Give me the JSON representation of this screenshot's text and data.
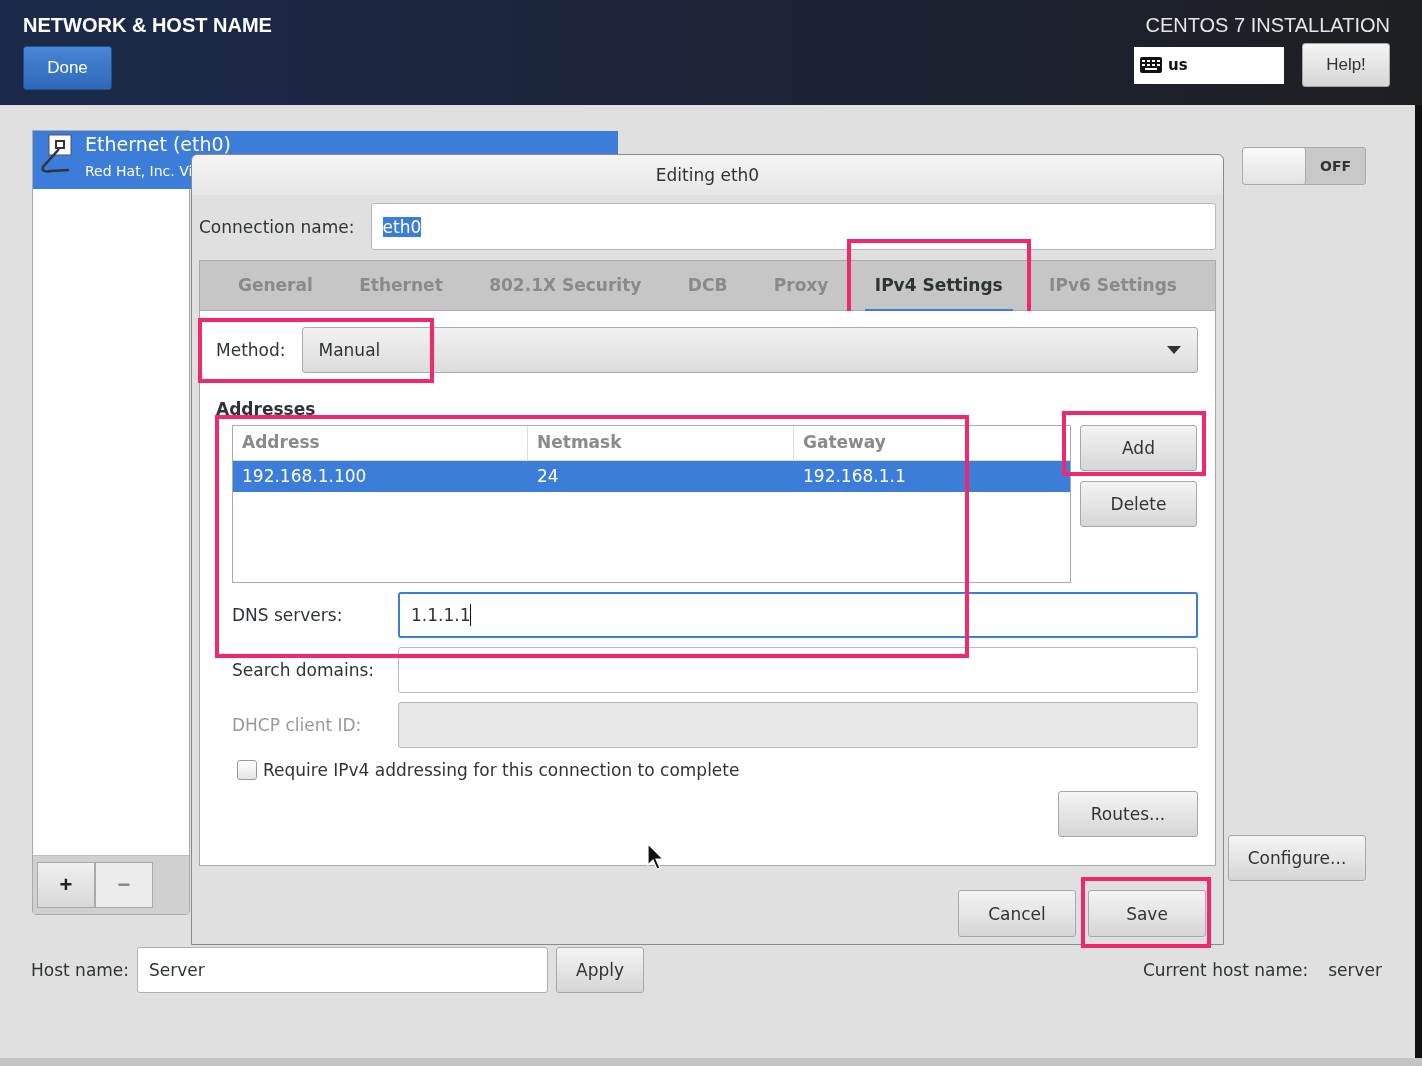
{
  "header": {
    "title": "NETWORK & HOST NAME",
    "done_button": "Done",
    "product": "CENTOS 7 INSTALLATION",
    "keyboard_layout": "us",
    "help_button": "Help!"
  },
  "devices": [
    {
      "name": "Ethernet (eth0)",
      "vendor": "Red Hat, Inc. Vi",
      "selected": true
    }
  ],
  "device_buttons": [
    "+",
    "−"
  ],
  "toggle": {
    "label": "OFF",
    "on": false
  },
  "configure_button": "Configure...",
  "host_name": {
    "label": "Host name:",
    "value": "Server",
    "apply_button": "Apply",
    "current_label": "Current host name:",
    "current_value": "server"
  },
  "dialog": {
    "title": "Editing eth0",
    "connection_name_label": "Connection name:",
    "connection_name": "eth0",
    "tabs": [
      {
        "label": "General",
        "selected": false,
        "highlighted": false
      },
      {
        "label": "Ethernet",
        "selected": false,
        "highlighted": false
      },
      {
        "label": "802.1X Security",
        "selected": false,
        "highlighted": false
      },
      {
        "label": "DCB",
        "selected": false,
        "highlighted": false
      },
      {
        "label": "Proxy",
        "selected": false,
        "highlighted": false
      },
      {
        "label": "IPv4 Settings",
        "selected": true,
        "highlighted": true
      },
      {
        "label": "IPv6 Settings",
        "selected": false,
        "highlighted": false
      }
    ],
    "method": {
      "label": "Method:",
      "value": "Manual",
      "highlighted": true
    },
    "addresses": {
      "title": "Addresses",
      "highlighted": true,
      "columns": [
        "Address",
        "Netmask",
        "Gateway"
      ],
      "rows": [
        {
          "cells": [
            "192.168.1.100",
            "24",
            "192.168.1.1"
          ],
          "selected": true
        }
      ]
    },
    "address_buttons": [
      {
        "label": "Add",
        "highlighted": true
      },
      {
        "label": "Delete"
      }
    ],
    "fields": [
      {
        "label": "DNS servers:",
        "value": "1.1.1.1",
        "disabled": false,
        "focused": true
      },
      {
        "label": "Search domains:",
        "disabled": false,
        "focused": false
      },
      {
        "label": "DHCP client ID:",
        "disabled": true,
        "focused": false
      }
    ],
    "require_checkbox": {
      "label": "Require IPv4 addressing for this connection to complete",
      "checked": false
    },
    "routes_button": "Routes...",
    "buttons": [
      {
        "label": "Cancel"
      },
      {
        "label": "Save",
        "highlighted": true
      }
    ]
  }
}
